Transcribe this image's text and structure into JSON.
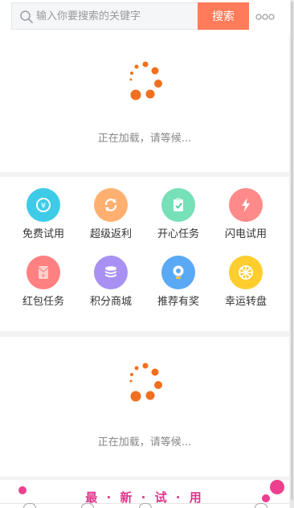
{
  "search": {
    "placeholder": "输入你要搜索的关键字",
    "button_label": "搜索"
  },
  "icons": {
    "search": "search-icon",
    "more": "more-icon"
  },
  "loading_top": {
    "text": "正在加载，请等候..."
  },
  "menu": {
    "items": [
      {
        "label": "免费试用",
        "icon": "free-trial-icon",
        "color": "#3ecbe8"
      },
      {
        "label": "超级返利",
        "icon": "rebate-icon",
        "color": "#ffb070"
      },
      {
        "label": "开心任务",
        "icon": "clipboard-task-icon",
        "color": "#76e0b8"
      },
      {
        "label": "闪电试用",
        "icon": "lightning-icon",
        "color": "#ff8a8a"
      },
      {
        "label": "红包任务",
        "icon": "red-envelope-icon",
        "color": "#ff8080"
      },
      {
        "label": "积分商城",
        "icon": "coin-stack-icon",
        "color": "#a891f2"
      },
      {
        "label": "推荐有奖",
        "icon": "recommend-icon",
        "color": "#5aa9f5"
      },
      {
        "label": "幸运转盘",
        "icon": "lucky-wheel-icon",
        "color": "#ffcd2e"
      }
    ]
  },
  "loading_bottom": {
    "text": "正在加载，请等候..."
  },
  "banner": {
    "title": "最 · 新 · 试 · 用"
  },
  "colors": {
    "accent": "#ff7b5a",
    "spinner": "#f07020",
    "banner_text": "#e0348c"
  }
}
